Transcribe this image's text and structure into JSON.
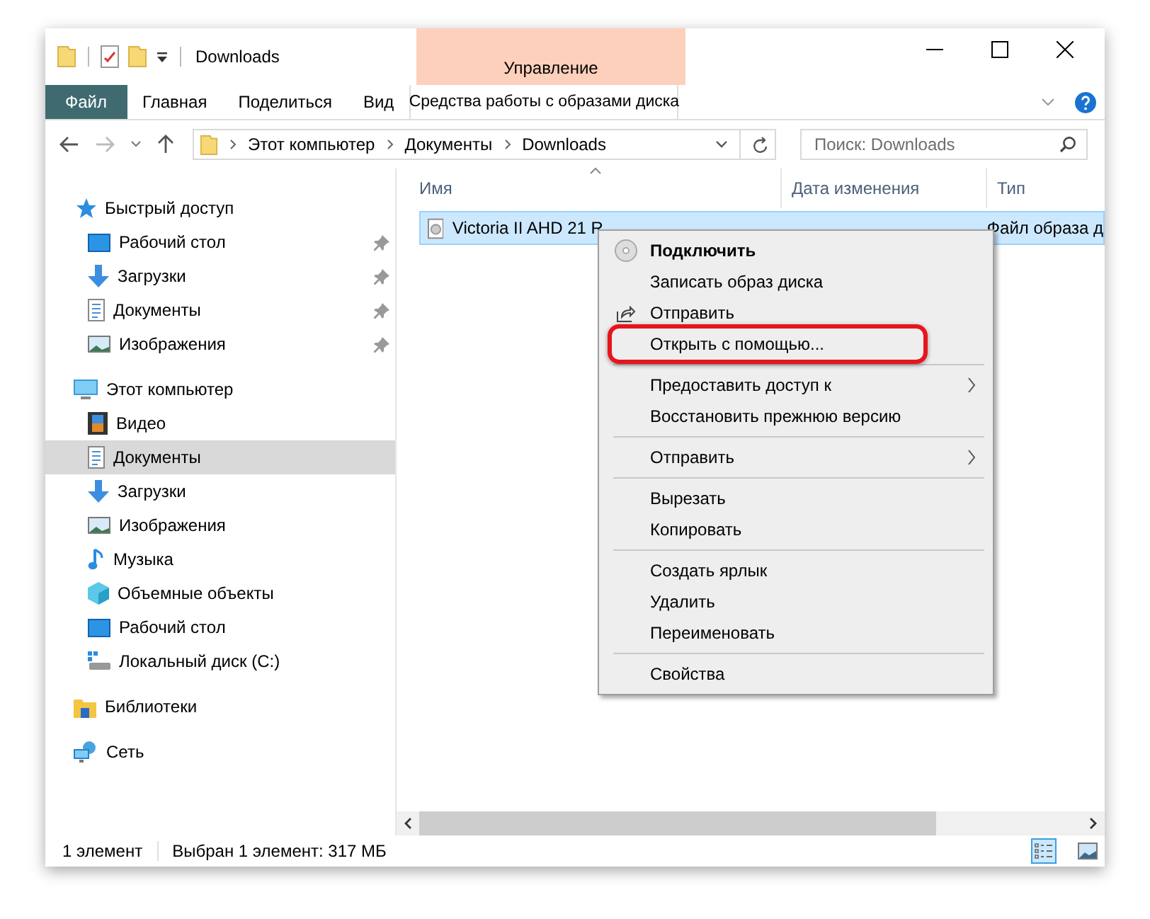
{
  "window": {
    "title": "Downloads"
  },
  "context_tab": {
    "group": "Управление",
    "tab": "Средства работы с образами диска"
  },
  "ribbon_tabs": [
    {
      "label": "Файл",
      "kind": "file"
    },
    {
      "label": "Главная",
      "kind": "tab"
    },
    {
      "label": "Поделиться",
      "kind": "tab"
    },
    {
      "label": "Вид",
      "kind": "tab"
    }
  ],
  "address": {
    "crumbs": [
      "Этот компьютер",
      "Документы",
      "Downloads"
    ]
  },
  "search": {
    "placeholder": "Поиск: Downloads"
  },
  "sidebar": {
    "items": [
      {
        "label": "Быстрый доступ",
        "kind": "star",
        "selected": false,
        "children": [
          {
            "label": "Рабочий стол",
            "kind": "desktop",
            "pinned": true,
            "selected": false
          },
          {
            "label": "Загрузки",
            "kind": "download",
            "pinned": true,
            "selected": false
          },
          {
            "label": "Документы",
            "kind": "document",
            "pinned": true,
            "selected": false
          },
          {
            "label": "Изображения",
            "kind": "pictures",
            "pinned": true,
            "selected": false
          }
        ]
      },
      {
        "label": "Этот компьютер",
        "kind": "computer",
        "selected": false,
        "children": [
          {
            "label": "Видео",
            "kind": "video",
            "pinned": false,
            "selected": false
          },
          {
            "label": "Документы",
            "kind": "document",
            "pinned": false,
            "selected": true
          },
          {
            "label": "Загрузки",
            "kind": "download",
            "pinned": false,
            "selected": false
          },
          {
            "label": "Изображения",
            "kind": "pictures",
            "pinned": false,
            "selected": false
          },
          {
            "label": "Музыка",
            "kind": "music",
            "pinned": false,
            "selected": false
          },
          {
            "label": "Объемные объекты",
            "kind": "cube",
            "pinned": false,
            "selected": false
          },
          {
            "label": "Рабочий стол",
            "kind": "desktop",
            "pinned": false,
            "selected": false
          },
          {
            "label": "Локальный диск (C:)",
            "kind": "drive",
            "pinned": false,
            "selected": false
          }
        ]
      },
      {
        "label": "Библиотеки",
        "kind": "library",
        "selected": false
      },
      {
        "label": "Сеть",
        "kind": "network",
        "selected": false
      }
    ]
  },
  "file_list": {
    "columns": [
      {
        "label": "Имя",
        "sorted": true
      },
      {
        "label": "Дата изменения",
        "sorted": false
      },
      {
        "label": "Тип",
        "sorted": false
      }
    ],
    "rows": [
      {
        "name": "Victoria II AHD 21 R",
        "type": "Файл образа д",
        "selected": true
      }
    ]
  },
  "context_menu": {
    "items": [
      {
        "kind": "disc",
        "label": "Подключить",
        "default": true,
        "submenu": false,
        "highlighted": false
      },
      {
        "kind": "item",
        "label": "Записать образ диска",
        "default": false,
        "submenu": false,
        "highlighted": false
      },
      {
        "kind": "share",
        "label": "Отправить",
        "default": false,
        "submenu": false,
        "highlighted": false
      },
      {
        "kind": "item",
        "label": "Открыть с помощью...",
        "default": false,
        "submenu": false,
        "highlighted": true
      },
      {
        "kind": "separator"
      },
      {
        "kind": "item",
        "label": "Предоставить доступ к",
        "default": false,
        "submenu": true,
        "highlighted": false
      },
      {
        "kind": "item",
        "label": "Восстановить прежнюю версию",
        "default": false,
        "submenu": false,
        "highlighted": false
      },
      {
        "kind": "separator"
      },
      {
        "kind": "item",
        "label": "Отправить",
        "default": false,
        "submenu": true,
        "highlighted": false
      },
      {
        "kind": "separator"
      },
      {
        "kind": "item",
        "label": "Вырезать",
        "default": false,
        "submenu": false,
        "highlighted": false
      },
      {
        "kind": "item",
        "label": "Копировать",
        "default": false,
        "submenu": false,
        "highlighted": false
      },
      {
        "kind": "separator"
      },
      {
        "kind": "item",
        "label": "Создать ярлык",
        "default": false,
        "submenu": false,
        "highlighted": false
      },
      {
        "kind": "item",
        "label": "Удалить",
        "default": false,
        "submenu": false,
        "highlighted": false
      },
      {
        "kind": "item",
        "label": "Переименовать",
        "default": false,
        "submenu": false,
        "highlighted": false
      },
      {
        "kind": "separator"
      },
      {
        "kind": "item",
        "label": "Свойства",
        "default": false,
        "submenu": false,
        "highlighted": false
      }
    ]
  },
  "status_bar": {
    "texts": [
      "1 элемент",
      "Выбран 1 элемент: 317 МБ"
    ],
    "views": [
      {
        "kind": "details",
        "selected": true
      },
      {
        "kind": "thumbnails",
        "selected": false
      }
    ]
  }
}
